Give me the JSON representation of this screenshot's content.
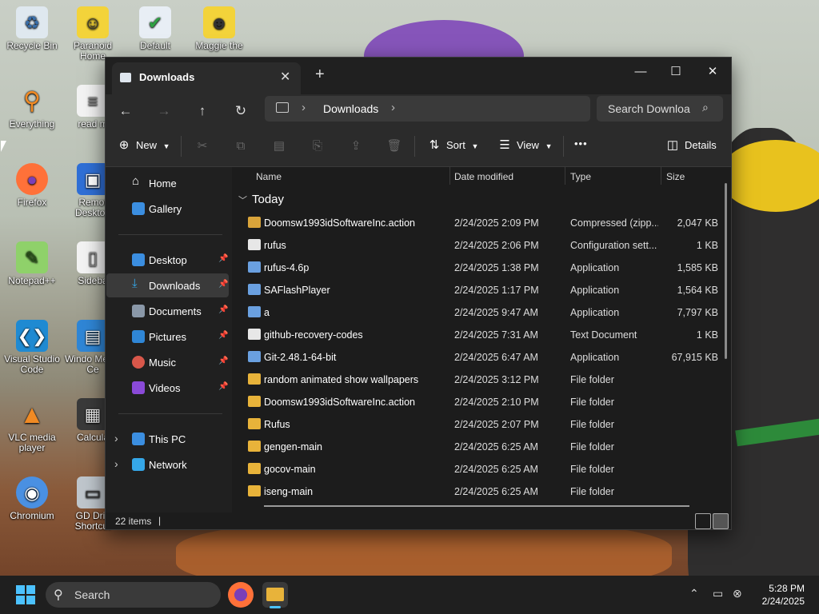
{
  "desktop": {
    "icons": [
      {
        "label": "Recycle Bin"
      },
      {
        "label": "Paranoid Home"
      },
      {
        "label": "Default"
      },
      {
        "label": "Maggie the"
      },
      {
        "label": "Everything"
      },
      {
        "label": "read m"
      },
      {
        "label": "Firefox"
      },
      {
        "label": "Remot Desktop"
      },
      {
        "label": "Notepad++"
      },
      {
        "label": "Sideba"
      },
      {
        "label": "Visual Studio Code"
      },
      {
        "label": "Windo Media Ce"
      },
      {
        "label": "VLC media player"
      },
      {
        "label": "Calcula"
      },
      {
        "label": "Chromium"
      },
      {
        "label": "GD Driv Shortcut"
      }
    ]
  },
  "window": {
    "tab_title": "Downloads",
    "new_tab": "+",
    "controls": {
      "minimize": "—",
      "maximize": "☐",
      "close": "✕"
    }
  },
  "nav": {
    "back": "←",
    "forward": "→",
    "up": "↑",
    "refresh": "↻",
    "breadcrumb": "Downloads",
    "chevron": "›",
    "search_placeholder": "Search Downloa",
    "search_icon": "⌕"
  },
  "toolbar": {
    "new_label": "New",
    "sort_label": "Sort",
    "view_label": "View",
    "more_label": "•••",
    "details_label": "Details",
    "icons": [
      "cut-icon",
      "copy-icon",
      "paste-icon",
      "rename-icon",
      "share-icon",
      "delete-icon"
    ]
  },
  "sidebar": {
    "home": "Home",
    "gallery": "Gallery",
    "pinned": [
      {
        "label": "Desktop",
        "color": "#3b8ee0"
      },
      {
        "label": "Downloads",
        "color": "#35a7e8"
      },
      {
        "label": "Documents",
        "color": "#8a98a8"
      },
      {
        "label": "Pictures",
        "color": "#2f86d6"
      },
      {
        "label": "Music",
        "color": "#d8574a"
      },
      {
        "label": "Videos",
        "color": "#8a4ad8"
      }
    ],
    "this_pc": "This PC",
    "network": "Network",
    "pin_glyph": "📌"
  },
  "columns": {
    "name": "Name",
    "date": "Date modified",
    "type": "Type",
    "size": "Size"
  },
  "group_label": "Today",
  "files": [
    {
      "name": "Doomsw1993idSoftwareInc.action",
      "date": "2/24/2025 2:09 PM",
      "type": "Compressed (zipp...",
      "size": "2,047 KB",
      "kind": "zip"
    },
    {
      "name": "rufus",
      "date": "2/24/2025 2:06 PM",
      "type": "Configuration sett...",
      "size": "1 KB",
      "kind": "file"
    },
    {
      "name": "rufus-4.6p",
      "date": "2/24/2025 1:38 PM",
      "type": "Application",
      "size": "1,585 KB",
      "kind": "app"
    },
    {
      "name": "SAFlashPlayer",
      "date": "2/24/2025 1:17 PM",
      "type": "Application",
      "size": "1,564 KB",
      "kind": "app"
    },
    {
      "name": "a",
      "date": "2/24/2025 9:47 AM",
      "type": "Application",
      "size": "7,797 KB",
      "kind": "app"
    },
    {
      "name": "github-recovery-codes",
      "date": "2/24/2025 7:31 AM",
      "type": "Text Document",
      "size": "1 KB",
      "kind": "file"
    },
    {
      "name": "Git-2.48.1-64-bit",
      "date": "2/24/2025 6:47 AM",
      "type": "Application",
      "size": "67,915 KB",
      "kind": "app"
    },
    {
      "name": "random animated show wallpapers",
      "date": "2/24/2025 3:12 PM",
      "type": "File folder",
      "size": "",
      "kind": "folder"
    },
    {
      "name": "Doomsw1993idSoftwareInc.action",
      "date": "2/24/2025 2:10 PM",
      "type": "File folder",
      "size": "",
      "kind": "folder"
    },
    {
      "name": "Rufus",
      "date": "2/24/2025 2:07 PM",
      "type": "File folder",
      "size": "",
      "kind": "folder"
    },
    {
      "name": "gengen-main",
      "date": "2/24/2025 6:25 AM",
      "type": "File folder",
      "size": "",
      "kind": "folder"
    },
    {
      "name": "gocov-main",
      "date": "2/24/2025 6:25 AM",
      "type": "File folder",
      "size": "",
      "kind": "folder"
    },
    {
      "name": "iseng-main",
      "date": "2/24/2025 6:25 AM",
      "type": "File folder",
      "size": "",
      "kind": "folder"
    }
  ],
  "status": {
    "item_count": "22 items",
    "divider": "|"
  },
  "taskbar": {
    "search_label": "Search",
    "time": "5:28 PM",
    "date": "2/24/2025",
    "tray_chevron": "⌃"
  }
}
